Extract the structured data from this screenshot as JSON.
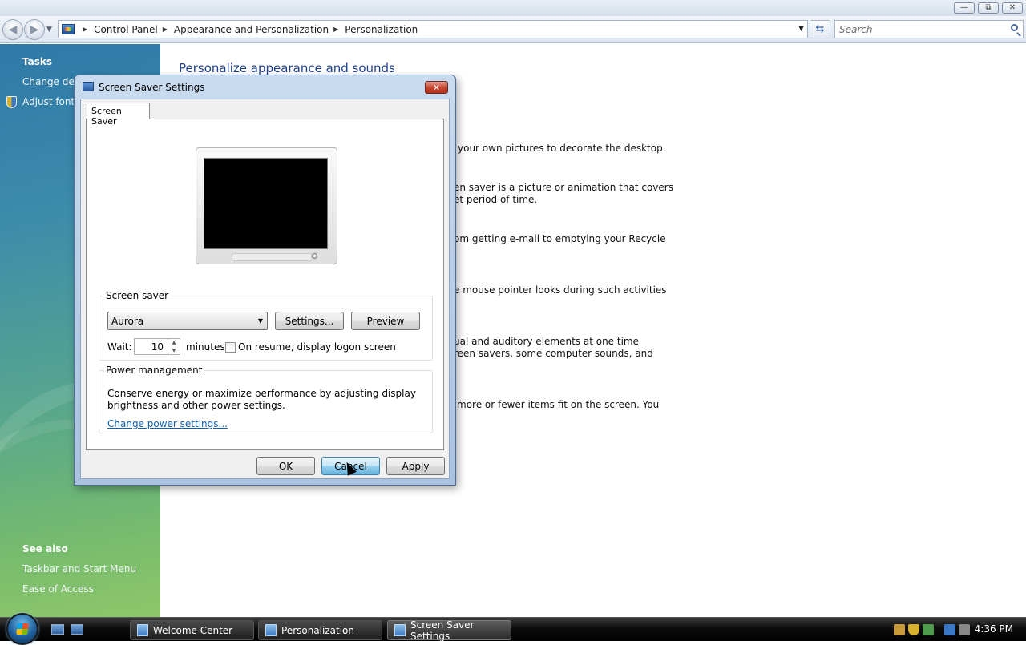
{
  "window": {
    "controls": {
      "minimize": "—",
      "maximize": "⧉",
      "close": "✕"
    }
  },
  "address_bar": {
    "back": "◀",
    "forward": "▶",
    "breadcrumbs": [
      "Control Panel",
      "Appearance and Personalization",
      "Personalization"
    ],
    "refresh_glyph": "⇆",
    "search_placeholder": "Search"
  },
  "task_pane": {
    "tasks_heading": "Tasks",
    "tasks": [
      "Change desktop icons",
      "Adjust font size (DPI)"
    ],
    "see_also_heading": "See also",
    "see_also": [
      "Taskbar and Start Menu",
      "Ease of Access"
    ]
  },
  "main": {
    "title": "Personalize appearance and sounds",
    "descriptions": [
      "your own pictures to decorate the desktop.",
      "en saver is a picture or animation that covers",
      "et period of time.",
      "om getting e-mail to emptying your Recycle",
      "e mouse pointer looks during such activities",
      "ual and auditory elements at one time",
      "reen savers, some computer sounds, and",
      "more or fewer items fit on the screen. You"
    ]
  },
  "dialog": {
    "title": "Screen Saver Settings",
    "close_glyph": "✕",
    "tab": "Screen Saver",
    "screen_saver_group": "Screen saver",
    "selected_screen_saver": "Aurora",
    "settings_button": "Settings...",
    "preview_button": "Preview",
    "wait_label": "Wait:",
    "wait_value": "10",
    "minutes_label": "minutes",
    "on_resume_label": "On resume, display logon screen",
    "on_resume_checked": false,
    "power_group": "Power management",
    "power_text": "Conserve energy or maximize performance by adjusting display brightness and other power settings.",
    "power_link": "Change power settings...",
    "ok_button": "OK",
    "cancel_button": "Cancel",
    "apply_button": "Apply"
  },
  "taskbar": {
    "items": [
      {
        "label": "Welcome Center",
        "active": false
      },
      {
        "label": "Personalization",
        "active": false
      },
      {
        "label": "Screen Saver Settings",
        "active": true
      }
    ],
    "clock": "4:36 PM"
  },
  "colors": {
    "link": "#0f60b1",
    "heading": "#1e3f8a",
    "pane_top": "#2f79a8",
    "pane_bottom": "#8ec76a"
  }
}
